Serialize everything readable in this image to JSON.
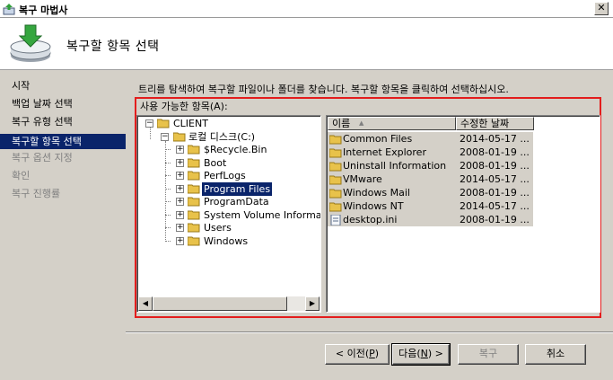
{
  "window": {
    "title": "복구 마법사",
    "close_glyph": "✕"
  },
  "header": {
    "title": "복구할 항목 선택"
  },
  "sidebar": {
    "items": [
      {
        "label": "시작",
        "state": "normal"
      },
      {
        "label": "백업 날짜 선택",
        "state": "normal"
      },
      {
        "label": "복구 유형 선택",
        "state": "normal"
      },
      {
        "label": "복구할 항목 선택",
        "state": "selected"
      },
      {
        "label": "복구 옵션 지정",
        "state": "disabled"
      },
      {
        "label": "확인",
        "state": "disabled"
      },
      {
        "label": "복구 진행률",
        "state": "disabled"
      }
    ]
  },
  "main": {
    "instruction": "트리를 탐색하여 복구할 파일이나 폴더를 찾습니다. 복구할 항목을 클릭하여 선택하십시오.",
    "available_label": "사용 가능한 항목(A):",
    "tree": {
      "root": "CLIENT",
      "drive": "로컬 디스크(C:)",
      "folders": [
        "$Recycle.Bin",
        "Boot",
        "PerfLogs",
        "Program Files",
        "ProgramData",
        "System Volume Informat",
        "Users",
        "Windows"
      ],
      "selected": "Program Files",
      "expander_plus": "+",
      "expander_minus": "−"
    },
    "list": {
      "columns": {
        "name": "이름",
        "date": "수정한 날짜"
      },
      "sort_arrow": "▲",
      "rows": [
        {
          "name": "Common Files",
          "date": "2014-05-17 ...",
          "type": "folder"
        },
        {
          "name": "Internet Explorer",
          "date": "2008-01-19 ...",
          "type": "folder"
        },
        {
          "name": "Uninstall Information",
          "date": "2008-01-19 ...",
          "type": "folder"
        },
        {
          "name": "VMware",
          "date": "2014-05-17 ...",
          "type": "folder"
        },
        {
          "name": "Windows Mail",
          "date": "2008-01-19 ...",
          "type": "folder"
        },
        {
          "name": "Windows NT",
          "date": "2014-05-17 ...",
          "type": "folder"
        },
        {
          "name": "desktop.ini",
          "date": "2008-01-19 ...",
          "type": "file"
        }
      ]
    },
    "scroll_left": "◀",
    "scroll_right": "▶"
  },
  "footer": {
    "back": {
      "text": "< 이전(",
      "key": "P",
      "suffix": ")"
    },
    "next": {
      "text": "다음(",
      "key": "N",
      "suffix": ") >"
    },
    "recover": "복구",
    "cancel": "취소"
  },
  "colors": {
    "highlight": "#0a246a",
    "frame": "#e31d1d",
    "folder": "#e8c24a"
  }
}
